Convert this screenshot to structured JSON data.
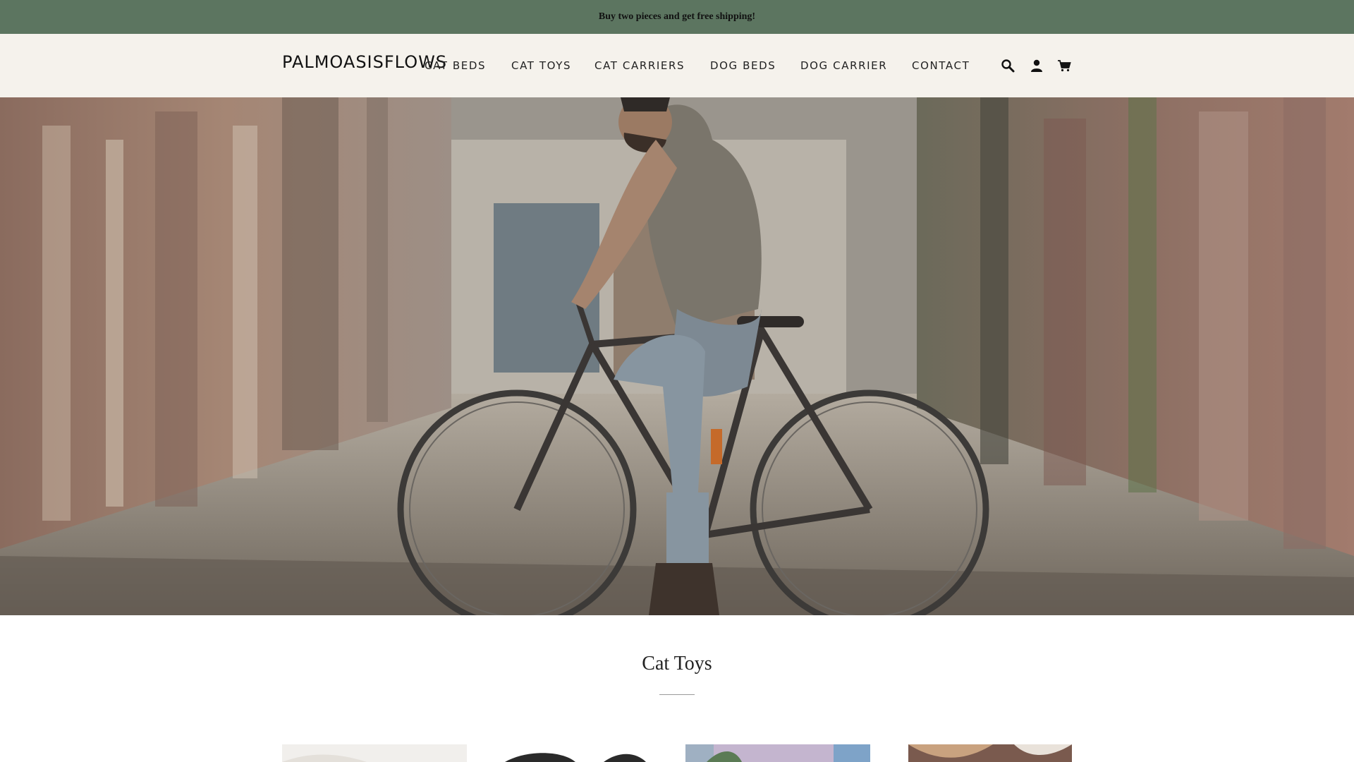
{
  "announcement": {
    "text": "Buy two pieces and get free shipping!"
  },
  "header": {
    "logo": "PALMOASISFLOWS",
    "nav": [
      {
        "label": "CAT BEDS"
      },
      {
        "label": "CAT TOYS"
      },
      {
        "label": "CAT CARRIERS"
      },
      {
        "label": "DOG BEDS"
      },
      {
        "label": "DOG CARRIER"
      },
      {
        "label": "CONTACT"
      }
    ],
    "icons": [
      "search-icon",
      "account-icon",
      "cart-icon"
    ]
  },
  "hero": {
    "image": "man-on-bicycle-in-graffiti-alley"
  },
  "collection": {
    "title": "Cat Toys",
    "product_count_visible": 4
  },
  "colors": {
    "announcement_bg": "#5c7560",
    "header_bg": "#f5f2ec",
    "text": "#222222"
  }
}
